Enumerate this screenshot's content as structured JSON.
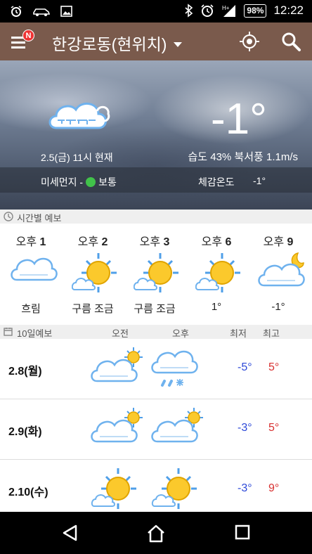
{
  "status_bar": {
    "time": "12:22",
    "battery": "98%",
    "left_icons": [
      "alarm-icon",
      "car-icon",
      "image-icon"
    ],
    "right_icons": [
      "bluetooth-icon",
      "alarm-icon",
      "signal-icon"
    ]
  },
  "app_bar": {
    "title": "한강로동(현위치)",
    "menu_badge": "N",
    "accent": "#7a5a4c"
  },
  "current": {
    "temperature": "-1°",
    "observed": "2.5(금) 11시 현재",
    "humidity_wind": "습도 43% 북서풍 1.1m/s",
    "dust_label": "미세먼지 -",
    "dust_status": "보통",
    "dust_color": "#41c24a",
    "feels_label": "체감온도",
    "feels_value": "-1°",
    "icon": "cloudy-wind-icon"
  },
  "hourly": {
    "header": "시간별 예보",
    "items": [
      {
        "prefix": "오후",
        "hour": "1",
        "condition": "흐림",
        "icon": "cloud-icon"
      },
      {
        "prefix": "오후",
        "hour": "2",
        "condition": "구름 조금",
        "icon": "sun-cloud-icon"
      },
      {
        "prefix": "오후",
        "hour": "3",
        "condition": "구름 조금",
        "icon": "sun-cloud-icon"
      },
      {
        "prefix": "오후",
        "hour": "6",
        "condition": "1°",
        "icon": "sun-cloud-icon"
      },
      {
        "prefix": "오후",
        "hour": "9",
        "condition": "-1°",
        "icon": "moon-cloud-icon"
      }
    ]
  },
  "daily": {
    "header": "10일예보",
    "col_am": "오전",
    "col_pm": "오후",
    "col_min": "최저",
    "col_max": "최고",
    "rows": [
      {
        "date": "2.8(월)",
        "am_icon": "cloud-sun-icon",
        "pm_icon": "cloud-snow-rain-icon",
        "min": "-5°",
        "max": "5°"
      },
      {
        "date": "2.9(화)",
        "am_icon": "cloud-sun-icon",
        "pm_icon": "cloud-sun-icon",
        "min": "-3°",
        "max": "5°"
      },
      {
        "date": "2.10(수)",
        "am_icon": "sun-cloud-icon",
        "pm_icon": "sun-cloud-icon",
        "min": "-3°",
        "max": "9°"
      }
    ]
  },
  "nav": {
    "icons": [
      "back-icon",
      "home-icon",
      "recents-icon"
    ]
  }
}
